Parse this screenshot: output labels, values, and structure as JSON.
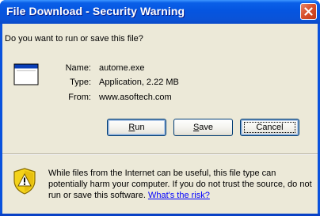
{
  "window": {
    "title": "File Download - Security Warning"
  },
  "dialog": {
    "question": "Do you want to run or save this file?",
    "file": {
      "name_label": "Name:",
      "name_value": "autome.exe",
      "type_label": "Type:",
      "type_value": "Application, 2.22 MB",
      "from_label": "From:",
      "from_value": "www.asoftech.com"
    },
    "buttons": {
      "run_prefix": "",
      "run_mnemonic": "R",
      "run_rest": "un",
      "save_prefix": "",
      "save_mnemonic": "S",
      "save_rest": "ave",
      "cancel": "Cancel"
    },
    "warning": {
      "line1": "While files from the Internet can be useful, this file type can",
      "line2": "potentially harm your computer. If you do not trust the source, do not",
      "line3_prefix": "run or save this software. ",
      "link": "What's the risk?"
    }
  },
  "icons": {
    "close": "close-icon",
    "file": "application-file-icon",
    "warning": "security-shield-warning-icon"
  },
  "colors": {
    "titlebar": "#0555e0",
    "dialog_background": "#ece9d8",
    "button_border": "#003c74",
    "link": "#0000ff",
    "close_button": "#d9512c",
    "shield_yellow": "#f3d21a"
  }
}
